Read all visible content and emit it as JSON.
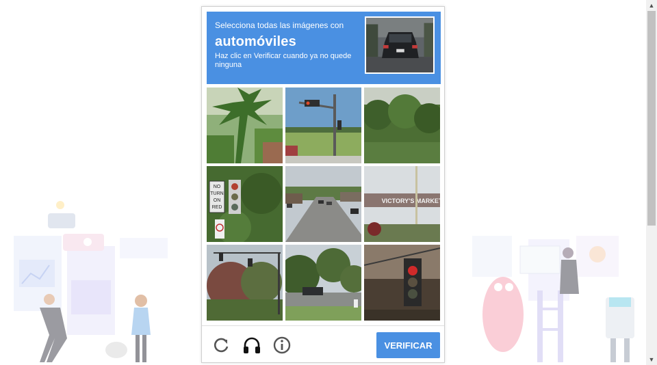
{
  "captcha": {
    "instruction": "Selecciona todas las imágenes con",
    "keyword": "automóviles",
    "hint": "Haz clic en Verificar cuando ya no quede ninguna",
    "verify_label": "VERIFICAR",
    "accent_color": "#4a90e2"
  },
  "tiles": [
    {
      "subject": "palm-tree"
    },
    {
      "subject": "traffic-light-street"
    },
    {
      "subject": "trees"
    },
    {
      "subject": "no-turn-on-red-sign"
    },
    {
      "subject": "road-with-cars"
    },
    {
      "subject": "store-sign"
    },
    {
      "subject": "traffic-light-trees"
    },
    {
      "subject": "street-with-car"
    },
    {
      "subject": "traffic-light-closeup"
    }
  ],
  "controls": {
    "reload_icon": "reload-icon",
    "audio_icon": "headphones-icon",
    "info_icon": "info-icon"
  },
  "sign_text": [
    "NO",
    "TURN",
    "ON",
    "RED"
  ],
  "store_sign_text": "VICTORY'S MARKET"
}
